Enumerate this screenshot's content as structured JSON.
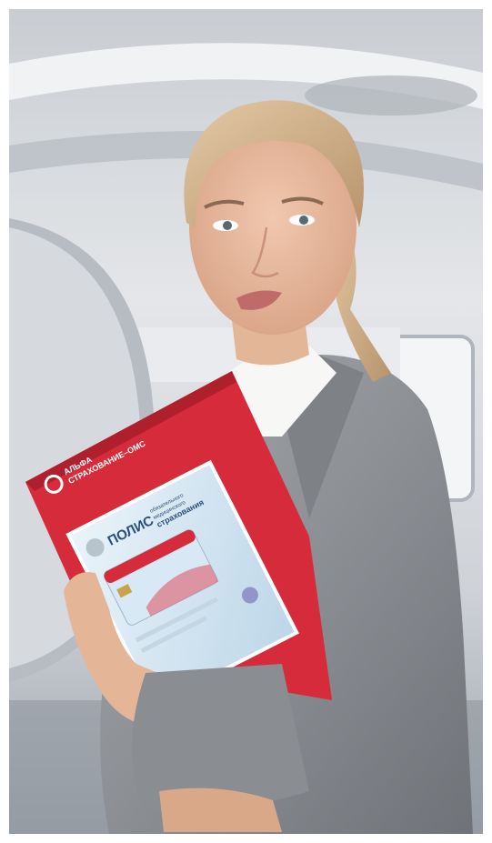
{
  "image": {
    "brand_line1": "АЛЬФА",
    "brand_line2": "СТРАХОВАНИЕ–ОМС",
    "policy_word": "ПОЛИС",
    "policy_sub1": "обязательного",
    "policy_sub2": "медицинского",
    "policy_sub3": "страхования",
    "colors": {
      "folder_red": "#d62b3a",
      "jacket_gray": "#8e9196",
      "background_light": "#e8eaed"
    }
  }
}
